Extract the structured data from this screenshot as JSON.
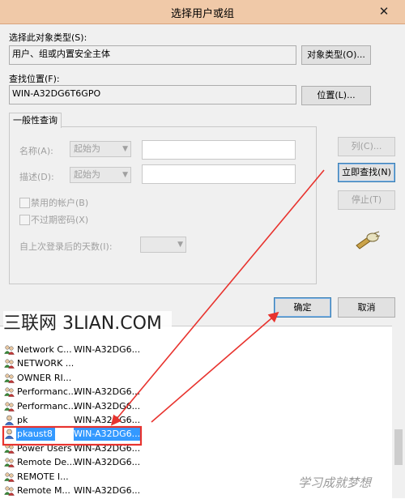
{
  "window": {
    "title": "选择用户或组",
    "close_glyph": "✕"
  },
  "object_type": {
    "label": "选择此对象类型(S):",
    "value": "用户、组或内置安全主体",
    "button": "对象类型(O)..."
  },
  "location": {
    "label": "查找位置(F):",
    "value": "WIN-A32DG6T6GPO",
    "button": "位置(L)..."
  },
  "common_query": {
    "tab": "一般性查询",
    "name_label": "名称(A):",
    "name_mode": "起始为",
    "desc_label": "描述(D):",
    "desc_mode": "起始为",
    "disabled_accounts": "禁用的帐户(B)",
    "no_expire_password": "不过期密码(X)",
    "days_since_logon_label": "自上次登录后的天数(I):"
  },
  "side_buttons": {
    "columns": "列(C)...",
    "find_now": "立即查找(N)",
    "stop": "停止(T)"
  },
  "footer": {
    "ok": "确定",
    "cancel": "取消"
  },
  "watermark": {
    "text": "三联网 3LIAN.COM",
    "corner": "学习成就梦想"
  },
  "results": {
    "rows": [
      {
        "name": "Network C...",
        "location": "WIN-A32DG6...",
        "icon": "group-icon"
      },
      {
        "name": "NETWORK ...",
        "location": "",
        "icon": "group-icon"
      },
      {
        "name": "OWNER RI...",
        "location": "",
        "icon": "group-icon"
      },
      {
        "name": "Performanc...",
        "location": "WIN-A32DG6...",
        "icon": "group-icon"
      },
      {
        "name": "Performanc...",
        "location": "WIN-A32DG6...",
        "icon": "group-icon"
      },
      {
        "name": "pk",
        "location": "WIN-A32DG6...",
        "icon": "user-icon"
      },
      {
        "name": "pkaust8",
        "location": "WIN-A32DG6...",
        "icon": "user-icon",
        "selected": true
      },
      {
        "name": "Power Users",
        "location": "WIN-A32DG6...",
        "icon": "group-icon"
      },
      {
        "name": "Remote De...",
        "location": "WIN-A32DG6...",
        "icon": "group-icon"
      },
      {
        "name": "REMOTE I...",
        "location": "",
        "icon": "group-icon"
      },
      {
        "name": "Remote M...",
        "location": "WIN-A32DG6...",
        "icon": "group-icon"
      }
    ]
  },
  "colors": {
    "annotation": "#e8332e",
    "selection": "#3399ff",
    "titlebar": "#f0c9a8"
  }
}
